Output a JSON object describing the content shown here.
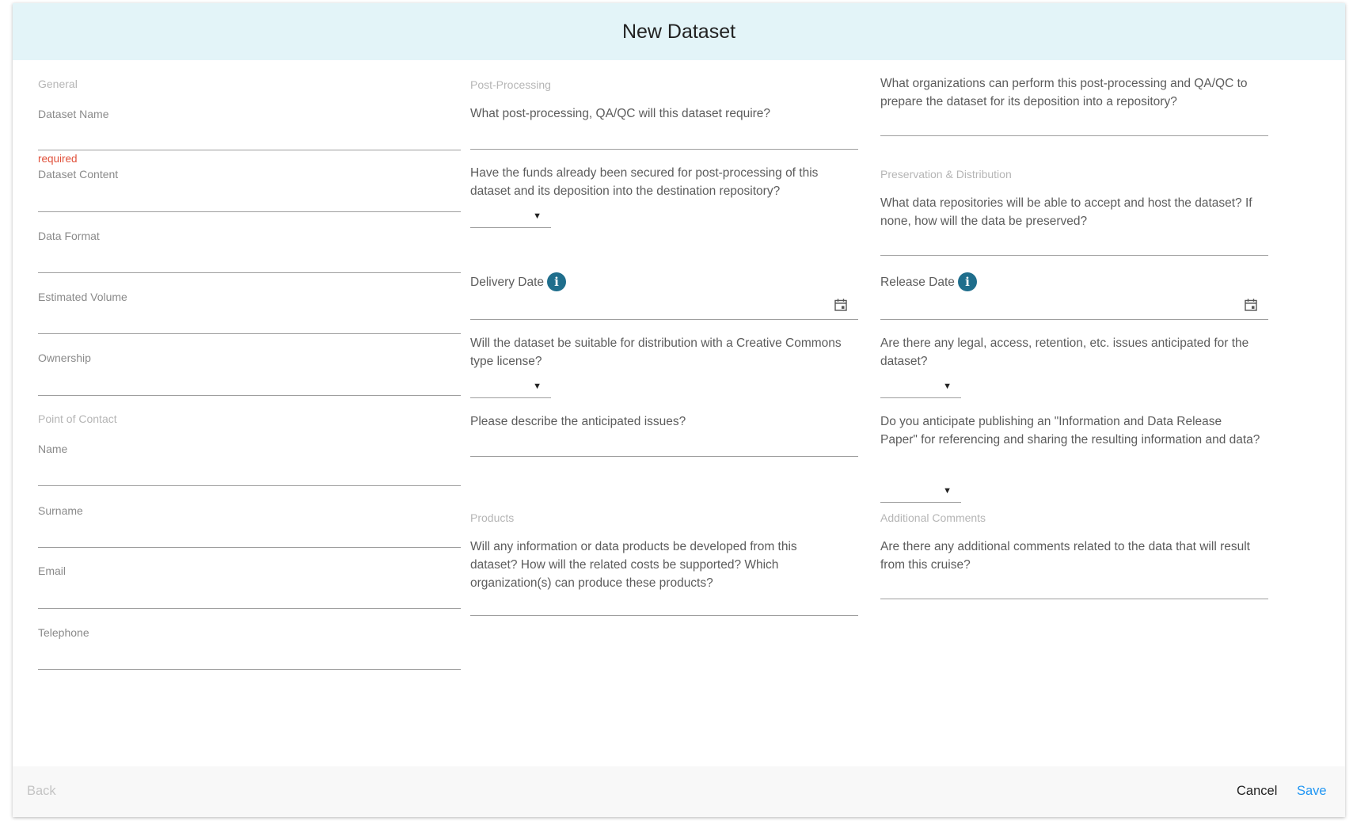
{
  "dialog": {
    "title": "New Dataset"
  },
  "general": {
    "section": "General",
    "dataset_name": {
      "label": "Dataset Name",
      "value": "",
      "error": "required"
    },
    "dataset_content": {
      "label": "Dataset Content",
      "value": ""
    },
    "data_format": {
      "label": "Data Format",
      "value": ""
    },
    "estimated_volume": {
      "label": "Estimated Volume",
      "value": ""
    },
    "ownership": {
      "label": "Ownership",
      "value": ""
    }
  },
  "contact": {
    "section": "Point of Contact",
    "name": {
      "label": "Name",
      "value": ""
    },
    "surname": {
      "label": "Surname",
      "value": ""
    },
    "email": {
      "label": "Email",
      "value": ""
    },
    "telephone": {
      "label": "Telephone",
      "value": ""
    }
  },
  "post_processing": {
    "section": "Post-Processing",
    "qaqc_question": "What post-processing, QA/QC will this dataset require?",
    "funds_question": "Have the funds already been secured for post-processing of this dataset and its deposition into the destination repository?",
    "funds_selected": "",
    "organizations_question": "What organizations can perform this post-processing and QA/QC to prepare the dataset for its deposition into a repository?"
  },
  "dates": {
    "delivery_label": "Delivery Date",
    "delivery_value": "",
    "release_label": "Release Date",
    "release_value": "",
    "info_glyph": "i"
  },
  "licensing": {
    "creative_commons_question": "Will the dataset be suitable for distribution with a Creative Commons type license?",
    "creative_commons_selected": "",
    "issues_describe_question": "Please describe the anticipated issues?",
    "legal_question": "Are there any legal, access, retention, etc. issues anticipated for the dataset?",
    "legal_selected": ""
  },
  "preservation": {
    "section": "Preservation & Distribution",
    "repositories_question": "What data repositories will be able to accept and host the dataset? If none, how will the data be preserved?",
    "publishing_question": "Do you anticipate publishing an \"Information and Data Release Paper\" for referencing and sharing the resulting information and data?",
    "publishing_selected": ""
  },
  "products": {
    "section": "Products",
    "question": "Will any information or data products be developed from this dataset? How will the related costs be supported? Which organization(s) can produce these products?"
  },
  "comments": {
    "section": "Additional Comments",
    "question": "Are there any additional comments related to the data that will result from this cruise?"
  },
  "footer": {
    "back": "Back",
    "cancel": "Cancel",
    "save": "Save"
  },
  "colors": {
    "header_bg": "#e3f4f8",
    "accent": "#2196f3",
    "error": "#e0503a",
    "info_icon": "#1f6e8c"
  },
  "icons": {
    "dropdown": "caret-down-icon",
    "calendar": "calendar-icon",
    "info": "info-icon"
  }
}
